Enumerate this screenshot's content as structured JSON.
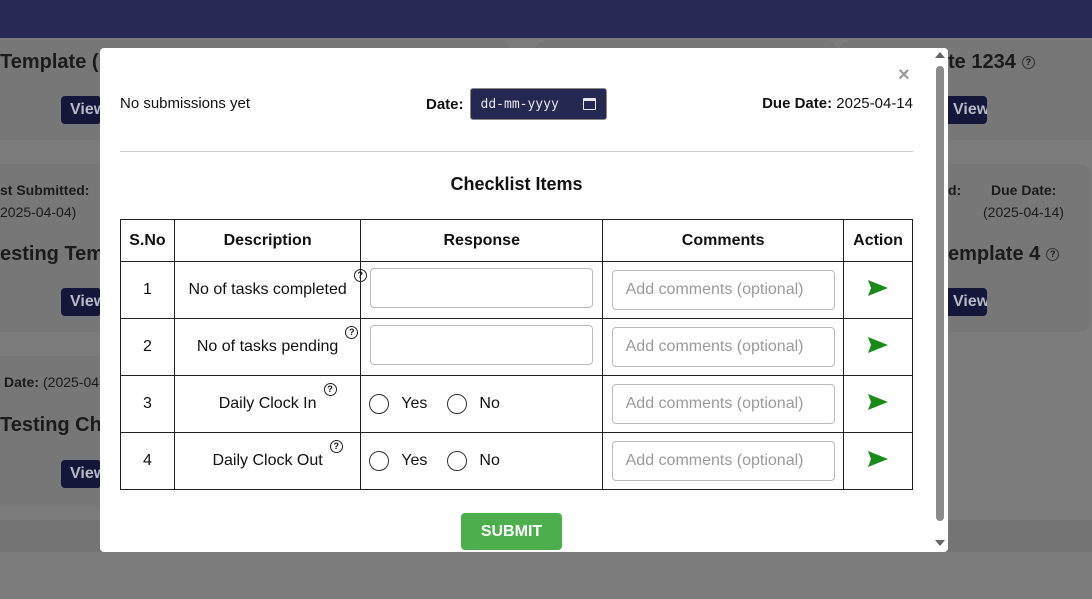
{
  "background": {
    "cards": [
      {
        "title": "Template (",
        "button": "View"
      },
      {
        "title": "te 1234",
        "button": "View"
      },
      {
        "title": "esting Tem",
        "button": "View"
      },
      {
        "title": "emplate 4",
        "button": "View"
      },
      {
        "title": "Testing Ch",
        "button": "View"
      }
    ],
    "last_submitted_label": "st Submitted:",
    "last_submitted_value": "2025-04-04)",
    "right_label_partial": "d:",
    "right_due_label": "Due Date:",
    "right_due_value": "(2025-04-14)",
    "left_due_label": "Date:",
    "left_due_value": "(2025-04"
  },
  "modal": {
    "close_label": "×",
    "submission_status": "No submissions yet",
    "date_label": "Date:",
    "date_placeholder": "dd-mm-yyyy",
    "due_date_label": "Due Date:",
    "due_date_value": "2025-04-14",
    "section_title": "Checklist Items",
    "table": {
      "headers": [
        "S.No",
        "Description",
        "Response",
        "Comments",
        "Action"
      ],
      "rows": [
        {
          "sno": "1",
          "description": "No of tasks completed",
          "response_type": "text",
          "comment_placeholder": "Add comments (optional)"
        },
        {
          "sno": "2",
          "description": "No of tasks pending",
          "response_type": "text",
          "comment_placeholder": "Add comments (optional)"
        },
        {
          "sno": "3",
          "description": "Daily Clock In",
          "response_type": "radio",
          "yes": "Yes",
          "no": "No",
          "comment_placeholder": "Add comments (optional)"
        },
        {
          "sno": "4",
          "description": "Daily Clock Out",
          "response_type": "radio",
          "yes": "Yes",
          "no": "No",
          "comment_placeholder": "Add comments (optional)"
        }
      ]
    },
    "help_icon_glyph": "?",
    "submit_label": "SUBMIT"
  },
  "colors": {
    "topbar": "#282a55",
    "submit_button": "#4cae4c",
    "send_icon": "#1a8a1a",
    "date_input_bg": "#252850"
  },
  "icons": [
    "close-icon",
    "help-icon",
    "send-icon",
    "calendar-icon"
  ]
}
